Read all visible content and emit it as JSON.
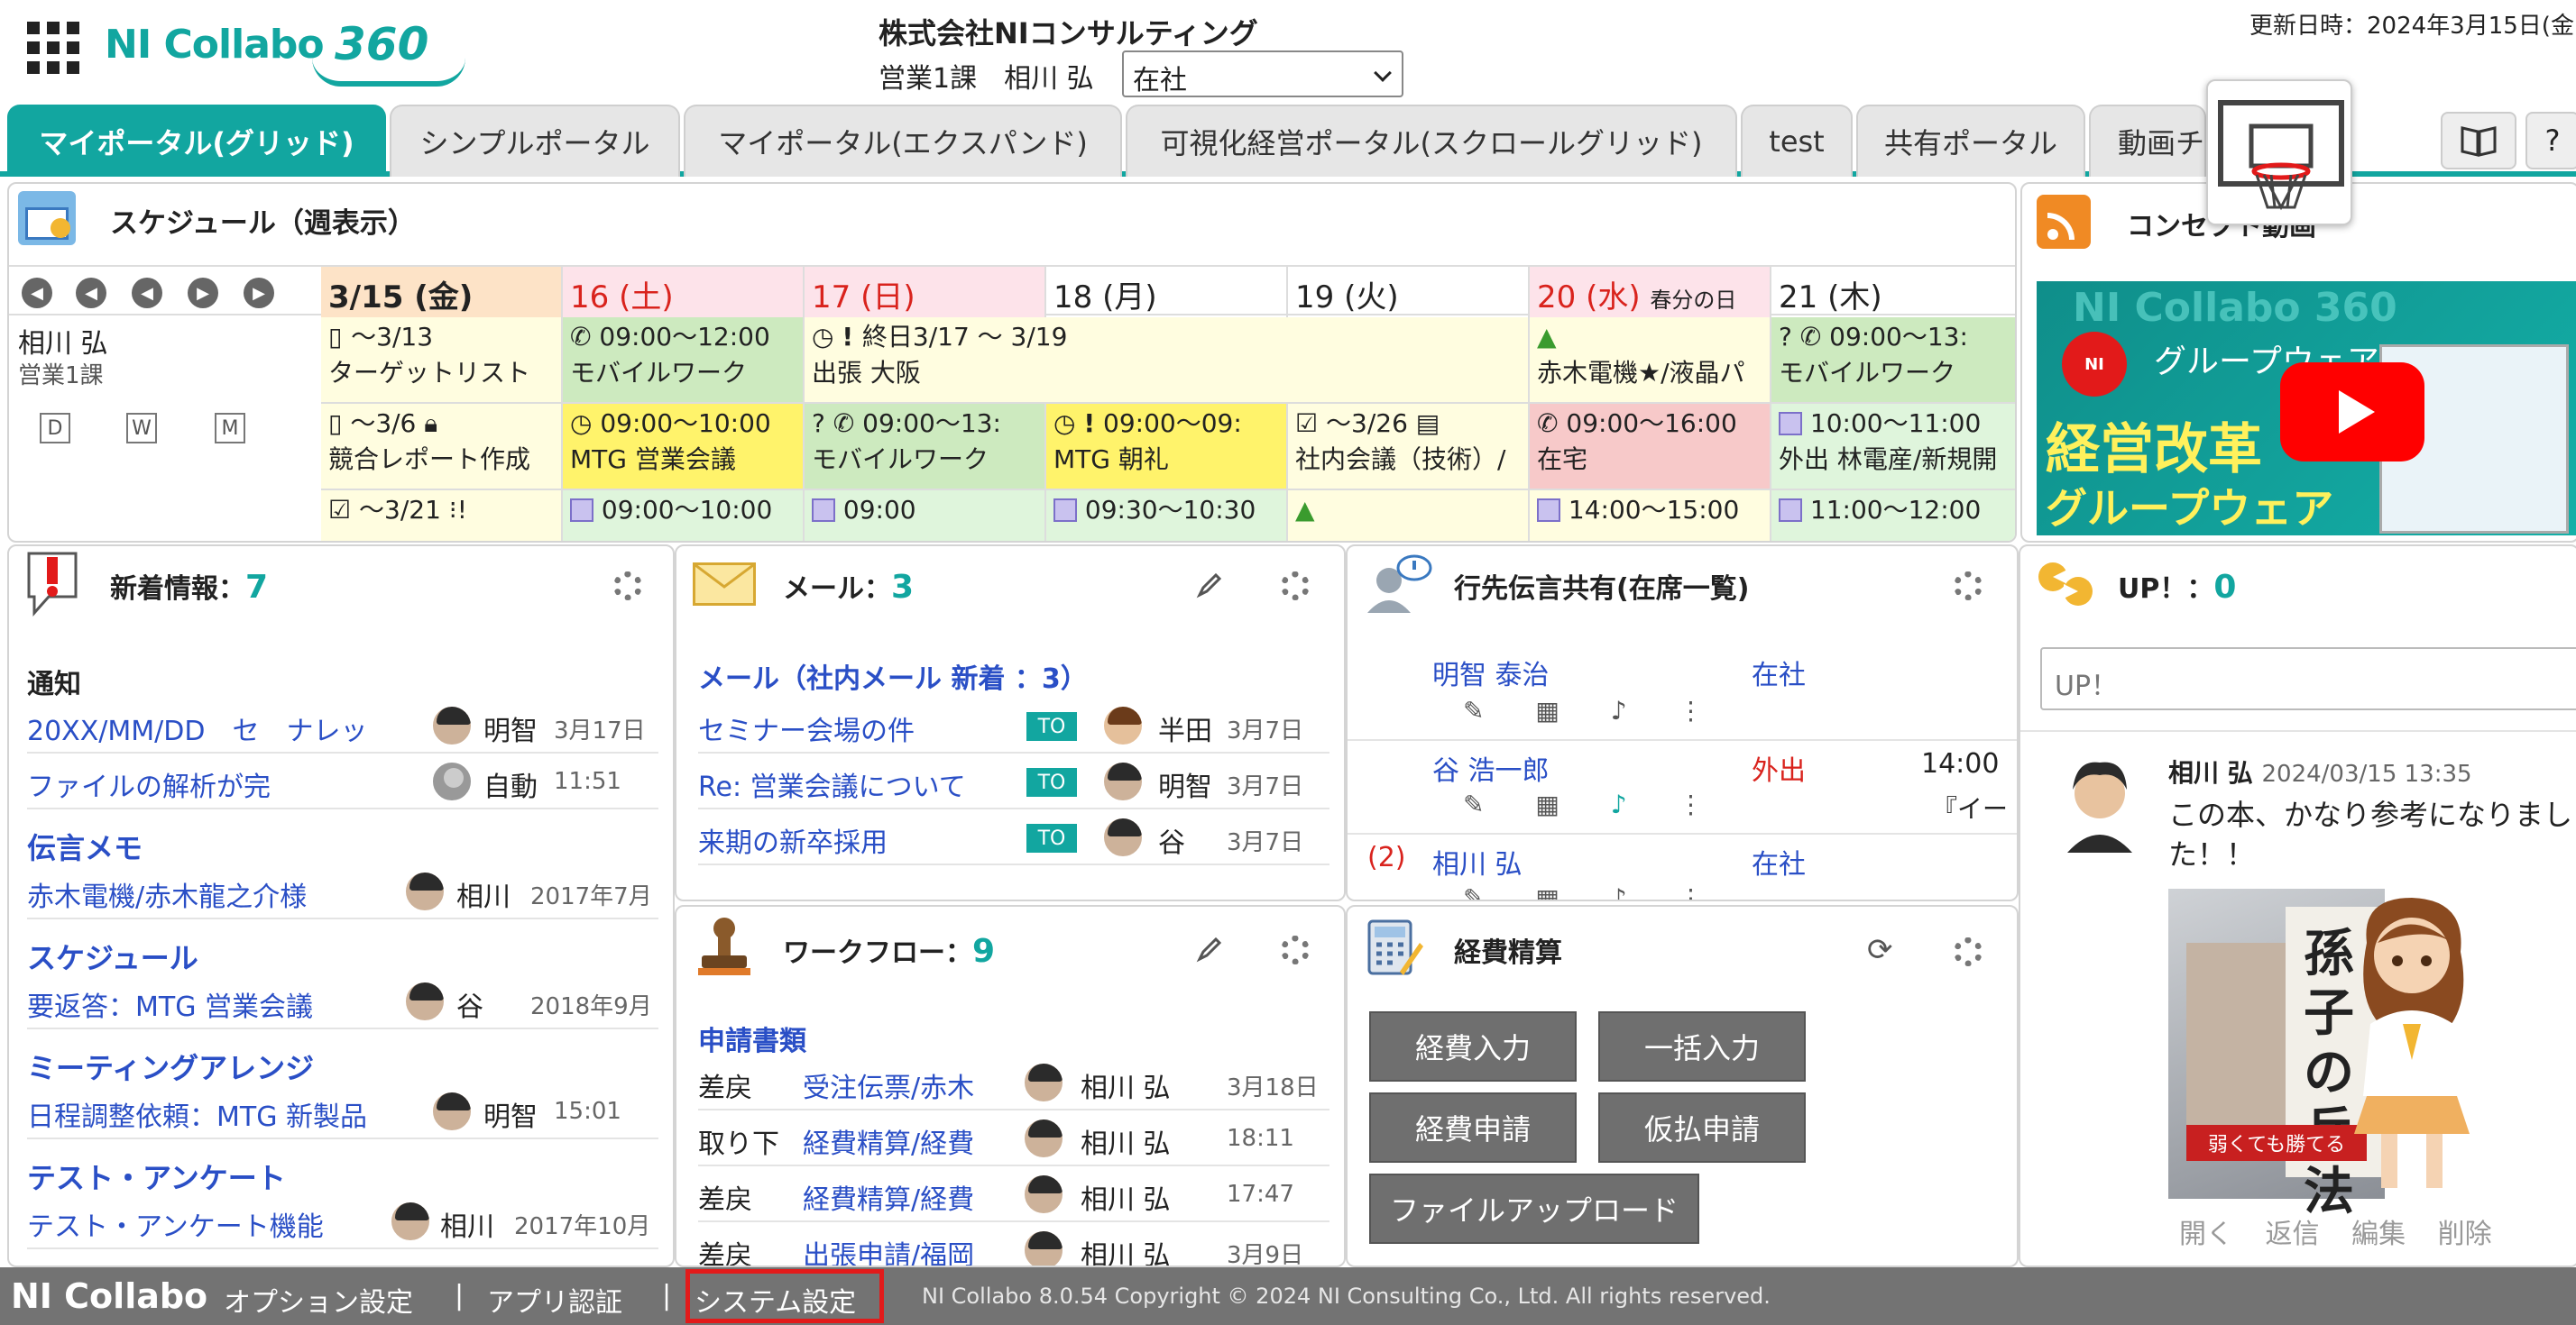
{
  "header": {
    "logo_text": "NI Collabo",
    "logo_number": "360",
    "company": "株式会社NIコンサルティング",
    "department": "営業1課　相川 弘",
    "status_value": "在社",
    "updated": "更新日時：2024年3月15日(金"
  },
  "tabs": [
    {
      "label": "マイポータル(グリッド)"
    },
    {
      "label": "シンプルポータル"
    },
    {
      "label": "マイポータル(エクスパンド)"
    },
    {
      "label": "可視化経営ポータル(スクロールグリッド)"
    },
    {
      "label": "test"
    },
    {
      "label": "共有ポータル"
    },
    {
      "label": "動画チ"
    }
  ],
  "schedule": {
    "title": "スケジュール（週表示）",
    "days": [
      "3/15 (金)",
      "16 (土)",
      "17 (日)",
      "18 (月)",
      "19 (火)",
      "20 (水)",
      "21 (木)"
    ],
    "holiday": "春分の日",
    "user_name": "相川 弘",
    "user_dept": "営業1課",
    "view_buttons": [
      "D",
      "W",
      "M"
    ],
    "row1": {
      "e1_top": "～3/13",
      "e1_bottom": "ターゲットリスト",
      "e2_top": "09:00～12:00",
      "e2_bottom": "モバイルワーク",
      "e3_top": "終日3/17 ～ 3/19",
      "e3_bottom": "出張 大阪",
      "e4_bottom": "赤木電機★/液晶パ",
      "e5_top": "09:00～13:",
      "e5_bottom": "モバイルワーク"
    },
    "row2": {
      "e1_top": "～3/6",
      "e1_bottom": "競合レポート作成",
      "e2_top": "09:00～10:00",
      "e2_bottom": "MTG 営業会議",
      "e3_top": "09:00～13:",
      "e3_bottom": "モバイルワーク",
      "e4_top": "09:00～09:",
      "e4_bottom": "MTG 朝礼",
      "e5_top": "～3/26",
      "e5_bottom": "社内会議（技術）/",
      "e6_top": "09:00～16:00",
      "e6_bottom": "在宅",
      "e7_top": "10:00～11:00",
      "e7_bottom": "外出 林電産/新規開"
    },
    "row3": [
      "～3/21",
      "09:00～10:00",
      "09:00",
      "09:30～10:30",
      "",
      "14:00～15:00",
      "11:00～12:00"
    ]
  },
  "concept": {
    "title": "コンセプト動画",
    "video_logo": "NI Collabo 360",
    "video_line1": "グループウェア『NI…",
    "video_line2": "経営改革",
    "video_line3": "グループウェア"
  },
  "news": {
    "title": "新着情報",
    "count": "7",
    "sections": [
      {
        "heading": "通知",
        "items": [
          {
            "title": "20XX/MM/DD　セ　ナレッ",
            "who": "明智",
            "date": "3月17日"
          },
          {
            "title": "ファイルの解析が完",
            "who": "自動",
            "date": "11:51"
          }
        ]
      },
      {
        "heading": "伝言メモ",
        "items": [
          {
            "title": "赤木電機/赤木龍之介様",
            "who": "相川",
            "date": "2017年7月"
          }
        ]
      },
      {
        "heading": "スケジュール",
        "items": [
          {
            "title": "要返答：MTG 営業会議",
            "who": "谷",
            "date": "2018年9月"
          }
        ]
      },
      {
        "heading": "ミーティングアレンジ",
        "items": [
          {
            "title": "日程調整依頼：MTG 新製品",
            "who": "明智",
            "date": "15:01"
          }
        ]
      },
      {
        "heading": "テスト・アンケート",
        "items": [
          {
            "title": "テスト・アンケート機能",
            "who": "相川",
            "date": "2017年10月"
          }
        ]
      }
    ]
  },
  "mail": {
    "title": "メール",
    "count": "3",
    "heading": "メール（社内メール 新着 ：3）",
    "badge": "TO",
    "items": [
      {
        "subject": "セミナー会場の件",
        "who": "半田",
        "date": "3月7日"
      },
      {
        "subject": "Re: 営業会議について",
        "who": "明智",
        "date": "3月7日"
      },
      {
        "subject": "来期の新卒採用",
        "who": "谷",
        "date": "3月7日"
      }
    ]
  },
  "messages": {
    "title": "行先伝言共有(在席一覧)",
    "people": [
      {
        "name": "明智 泰治",
        "status": "在社",
        "extra": "",
        "extra2": ""
      },
      {
        "name": "谷 浩一郎",
        "status": "外出",
        "extra": "14:00",
        "extra2": "『イー"
      },
      {
        "name": "相川 弘",
        "prefix": "(2)",
        "status": "在社",
        "extra": "",
        "extra2": ""
      }
    ]
  },
  "workflow": {
    "title": "ワークフロー",
    "count": "9",
    "heading": "申請書類",
    "items": [
      {
        "state": "差戻",
        "title": "受注伝票/赤木",
        "who": "相川 弘",
        "date": "3月18日"
      },
      {
        "state": "取り下",
        "title": "経費精算/経費",
        "who": "相川 弘",
        "date": "18:11"
      },
      {
        "state": "差戻",
        "title": "経費精算/経費",
        "who": "相川 弘",
        "date": "17:47"
      },
      {
        "state": "差戻",
        "title": "出張申請/福岡",
        "who": "相川 弘",
        "date": "3月9日"
      }
    ]
  },
  "expense": {
    "title": "経費精算",
    "buttons": [
      "経費入力",
      "一括入力",
      "経費申請",
      "仮払申請",
      "ファイルアップロード"
    ]
  },
  "up": {
    "title": "UP！",
    "count": "0",
    "placeholder": "UP！",
    "post_author": "相川 弘",
    "post_time": "2024/03/15 13:35",
    "post_text": "この本、かなり参考になりました！！",
    "book_title": "孫子の兵法",
    "book_sub": "弱くても勝てる",
    "actions": [
      "開く",
      "返信",
      "編集",
      "削除"
    ]
  },
  "footer": {
    "logo": "NI Collabo",
    "items": [
      "オプション設定",
      "アプリ認証",
      "システム設定"
    ],
    "separator": "|",
    "copyright": "NI Collabo 8.0.54 Copyright © 2024 NI Consulting Co., Ltd. All rights reserved."
  },
  "colors": {
    "accent": "#12a6a0",
    "link": "#2a4fc6",
    "holiday": "#d9231d",
    "highlight": "#e21a1a"
  }
}
